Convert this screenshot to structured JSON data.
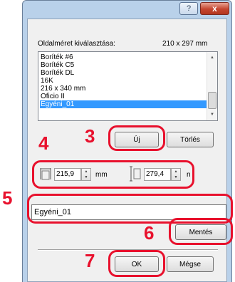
{
  "window": {
    "help_label": "?",
    "close_label": "x"
  },
  "page_size": {
    "label": "Oldalméret kiválasztása:",
    "size_text": "210 x 297 mm",
    "items": [
      "Boríték #6",
      "Boríték C5",
      "Boríték DL",
      "16K",
      "216 x 340 mm",
      "Oficio II",
      "Egyéni_01"
    ],
    "selected_index": 6
  },
  "buttons": {
    "new_label": "Új",
    "delete_label": "Törlés",
    "save_label": "Mentés",
    "ok_label": "OK",
    "cancel_label": "Mégse"
  },
  "dimensions": {
    "width_value": "215,9",
    "width_unit": "mm",
    "height_value": "279,4",
    "height_unit": "n"
  },
  "name_field": {
    "value": "Egyéni_01"
  },
  "steps": {
    "s3": "3",
    "s4": "4",
    "s5": "5",
    "s6": "6",
    "s7": "7"
  },
  "colors": {
    "highlight": "#e8112d",
    "selection": "#3399ff"
  }
}
